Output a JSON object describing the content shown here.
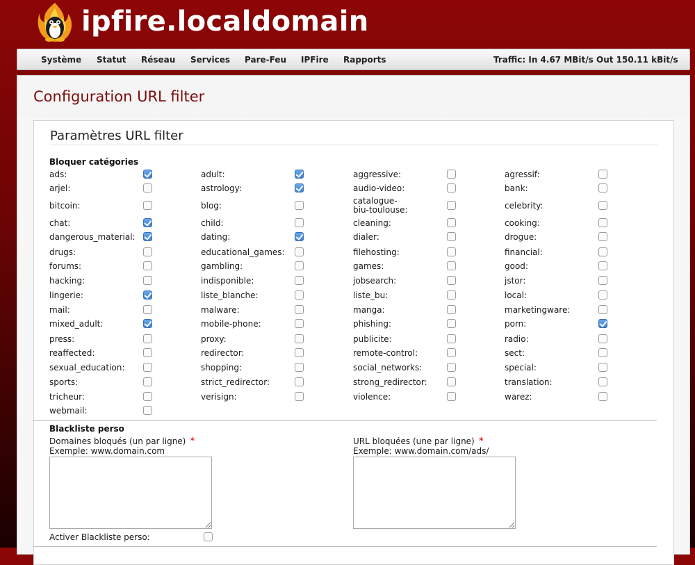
{
  "header": {
    "title": "ipfire.localdomain",
    "logo": "ipfire-penguin-flame-logo"
  },
  "nav": {
    "items": [
      "Système",
      "Statut",
      "Réseau",
      "Services",
      "Pare-Feu",
      "IPFire",
      "Rapports"
    ],
    "traffic_in": "Traffic: In 4.67 MBit/s",
    "traffic_out": "Out 150.11 kBit/s"
  },
  "page": {
    "title": "Configuration URL filter"
  },
  "section": {
    "title": "Paramètres URL filter",
    "block_categories_label": "Bloquer catégories"
  },
  "categories": [
    {
      "name": "ads:",
      "checked": true
    },
    {
      "name": "adult:",
      "checked": true
    },
    {
      "name": "aggressive:",
      "checked": false
    },
    {
      "name": "agressif:",
      "checked": false
    },
    {
      "name": "arjel:",
      "checked": false
    },
    {
      "name": "astrology:",
      "checked": true
    },
    {
      "name": "audio-video:",
      "checked": false
    },
    {
      "name": "bank:",
      "checked": false
    },
    {
      "name": "bitcoin:",
      "checked": false
    },
    {
      "name": "blog:",
      "checked": false
    },
    {
      "name": "catalogue-\nbiu-toulouse:",
      "checked": false
    },
    {
      "name": "celebrity:",
      "checked": false
    },
    {
      "name": "chat:",
      "checked": true
    },
    {
      "name": "child:",
      "checked": false
    },
    {
      "name": "cleaning:",
      "checked": false
    },
    {
      "name": "cooking:",
      "checked": false
    },
    {
      "name": "dangerous_material:",
      "checked": true
    },
    {
      "name": "dating:",
      "checked": true
    },
    {
      "name": "dialer:",
      "checked": false
    },
    {
      "name": "drogue:",
      "checked": false
    },
    {
      "name": "drugs:",
      "checked": false
    },
    {
      "name": "educational_games:",
      "checked": false
    },
    {
      "name": "filehosting:",
      "checked": false
    },
    {
      "name": "financial:",
      "checked": false
    },
    {
      "name": "forums:",
      "checked": false
    },
    {
      "name": "gambling:",
      "checked": false
    },
    {
      "name": "games:",
      "checked": false
    },
    {
      "name": "good:",
      "checked": false
    },
    {
      "name": "hacking:",
      "checked": false
    },
    {
      "name": "indisponible:",
      "checked": false
    },
    {
      "name": "jobsearch:",
      "checked": false
    },
    {
      "name": "jstor:",
      "checked": false
    },
    {
      "name": "lingerie:",
      "checked": true
    },
    {
      "name": "liste_blanche:",
      "checked": false
    },
    {
      "name": "liste_bu:",
      "checked": false
    },
    {
      "name": "local:",
      "checked": false
    },
    {
      "name": "mail:",
      "checked": false
    },
    {
      "name": "malware:",
      "checked": false
    },
    {
      "name": "manga:",
      "checked": false
    },
    {
      "name": "marketingware:",
      "checked": false
    },
    {
      "name": "mixed_adult:",
      "checked": true
    },
    {
      "name": "mobile-phone:",
      "checked": false
    },
    {
      "name": "phishing:",
      "checked": false
    },
    {
      "name": "porn:",
      "checked": true
    },
    {
      "name": "press:",
      "checked": false
    },
    {
      "name": "proxy:",
      "checked": false
    },
    {
      "name": "publicite:",
      "checked": false
    },
    {
      "name": "radio:",
      "checked": false
    },
    {
      "name": "reaffected:",
      "checked": false
    },
    {
      "name": "redirector:",
      "checked": false
    },
    {
      "name": "remote-control:",
      "checked": false
    },
    {
      "name": "sect:",
      "checked": false
    },
    {
      "name": "sexual_education:",
      "checked": false
    },
    {
      "name": "shopping:",
      "checked": false
    },
    {
      "name": "social_networks:",
      "checked": false
    },
    {
      "name": "special:",
      "checked": false
    },
    {
      "name": "sports:",
      "checked": false
    },
    {
      "name": "strict_redirector:",
      "checked": false
    },
    {
      "name": "strong_redirector:",
      "checked": false
    },
    {
      "name": "translation:",
      "checked": false
    },
    {
      "name": "tricheur:",
      "checked": false
    },
    {
      "name": "verisign:",
      "checked": false
    },
    {
      "name": "violence:",
      "checked": false
    },
    {
      "name": "warez:",
      "checked": false
    },
    {
      "name": "webmail:",
      "checked": false
    }
  ],
  "blacklist": {
    "title": "Blackliste perso",
    "domains_label": "Domaines bloqués (un par ligne)",
    "domains_example": "Exemple: www.domain.com",
    "domains_value": "",
    "urls_label": "URL bloquées (une par ligne)",
    "urls_example": "Exemple: www.domain.com/ads/",
    "urls_value": "",
    "required_mark": "*",
    "activate_label": "Activer Blackliste perso:",
    "activate_checked": false
  }
}
